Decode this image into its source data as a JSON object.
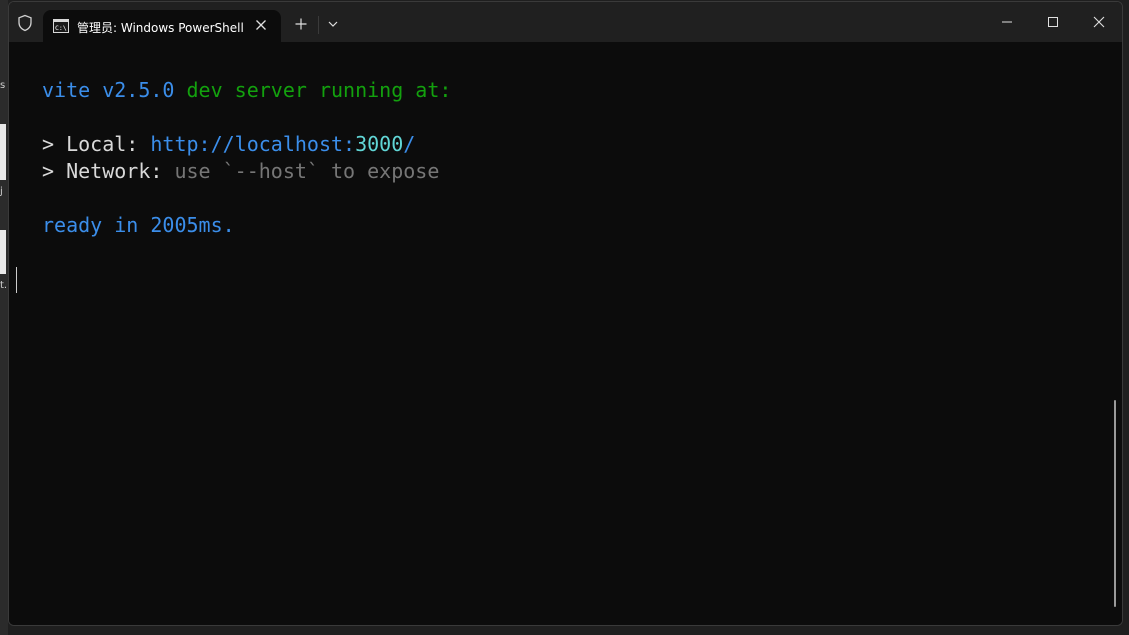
{
  "window": {
    "tab_title": "管理员: Windows PowerShell"
  },
  "terminal": {
    "banner": {
      "name": "vite",
      "version": "v2.5.0",
      "message": "dev server running at:"
    },
    "local": {
      "prefix": "> ",
      "label": "Local:",
      "url_base": "http://localhost:",
      "url_port": "3000",
      "url_tail": "/"
    },
    "network": {
      "prefix": "> ",
      "label": "Network:",
      "hint": "use `--host` to expose"
    },
    "ready": "ready in 2005ms."
  },
  "colors": {
    "terminal_bg": "#0c0c0c",
    "blue": "#3b8eea",
    "green": "#13a10e",
    "cyan": "#61d6d6",
    "grey": "#767676",
    "titlebar_bg": "#202020"
  },
  "icons": {
    "shield": "shield-icon",
    "tab": "terminal-icon",
    "close_tab": "close-icon",
    "new_tab": "plus-icon",
    "dropdown": "chevron-down-icon",
    "minimize": "minimize-icon",
    "maximize": "maximize-icon",
    "close_window": "close-icon"
  }
}
